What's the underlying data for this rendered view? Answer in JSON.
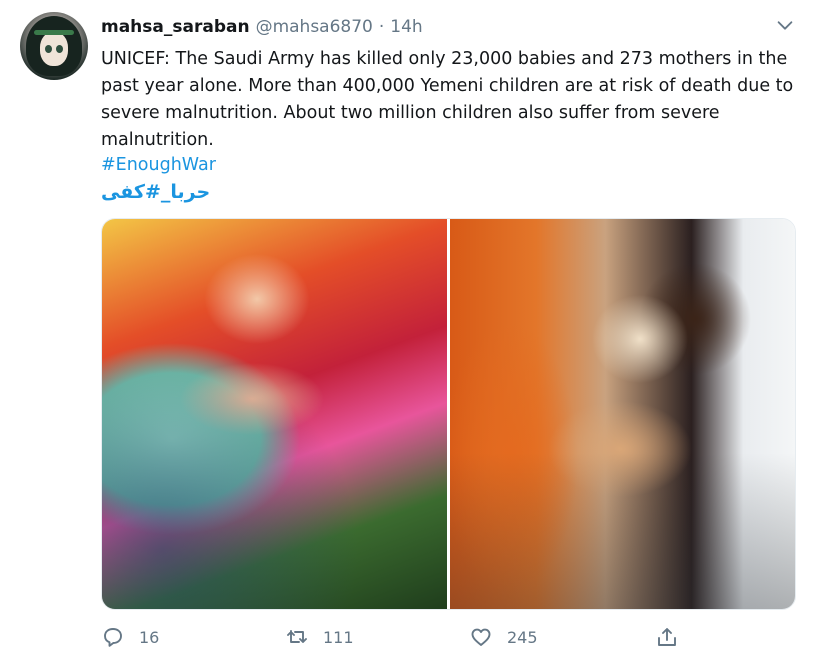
{
  "tweet": {
    "display_name": "mahsa_saraban",
    "handle": "@mahsa6870",
    "separator": "·",
    "time": "14h",
    "text": "UNICEF: The Saudi Army has killed only 23,000 babies and 273 mothers in the past year alone. More than 400,000 Yemeni children are at risk of death due to severe malnutrition. About two million children also suffer from severe malnutrition.",
    "hashtags": [
      "#EnoughWar",
      "حربا_#کفی"
    ]
  },
  "actions": {
    "reply_count": "16",
    "retweet_count": "111",
    "like_count": "245"
  },
  "colors": {
    "link": "#1b95e0",
    "muted": "#657786",
    "text": "#14171a"
  },
  "icons": [
    "caret-down-icon",
    "reply-icon",
    "retweet-icon",
    "like-icon",
    "share-icon"
  ]
}
